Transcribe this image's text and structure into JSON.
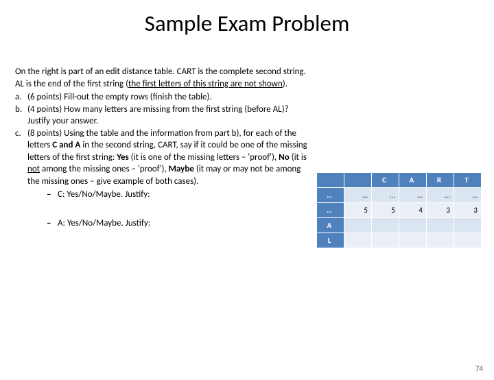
{
  "title": "Sample Exam Problem",
  "intro": {
    "t1": "On the right is part of an edit distance table.  CART is the complete second string.  AL is the end of the first string (",
    "t2": "the first letters of this string are not shown",
    "t3": ")."
  },
  "items": {
    "a": {
      "label": "a.",
      "text": "(6 points) Fill-out the empty rows (finish the table)."
    },
    "b": {
      "label": "b.",
      "text": "(4 points) How many letters are missing from the first string (before AL)? Justify your answer."
    },
    "c": {
      "label": "c.",
      "t1": "(8 points) Using the table and the information from part b), for each of the letters ",
      "t2": "C and A",
      "t3": " in the second string, CART, say if it could be one of the missing letters of the first string: ",
      "t4": "Yes",
      "t5": " (it is one of the missing letters – 'proof'), ",
      "t6": "No",
      "t7": " (it is ",
      "t8": "not",
      "t9": " among the missing ones – 'proof'), ",
      "t10": "Maybe",
      "t11": " (it may or may not be among the missing ones – give example of both cases)."
    }
  },
  "sub": {
    "c_line": "C:   Yes/No/Maybe. Justify:",
    "a_line": "A:   Yes/No/Maybe. Justify:"
  },
  "table": {
    "headers": [
      "",
      "",
      "C",
      "A",
      "R",
      "T"
    ],
    "row1": {
      "label": "…",
      "cells": [
        "…",
        "…",
        "…",
        "…",
        "…"
      ]
    },
    "row2": {
      "label": "…",
      "cells": [
        "5",
        "5",
        "4",
        "3",
        "3"
      ]
    },
    "row3": {
      "label": "A",
      "cells": [
        "",
        "",
        "",
        "",
        ""
      ]
    },
    "row4": {
      "label": "L",
      "cells": [
        "",
        "",
        "",
        "",
        ""
      ]
    }
  },
  "page": "74"
}
